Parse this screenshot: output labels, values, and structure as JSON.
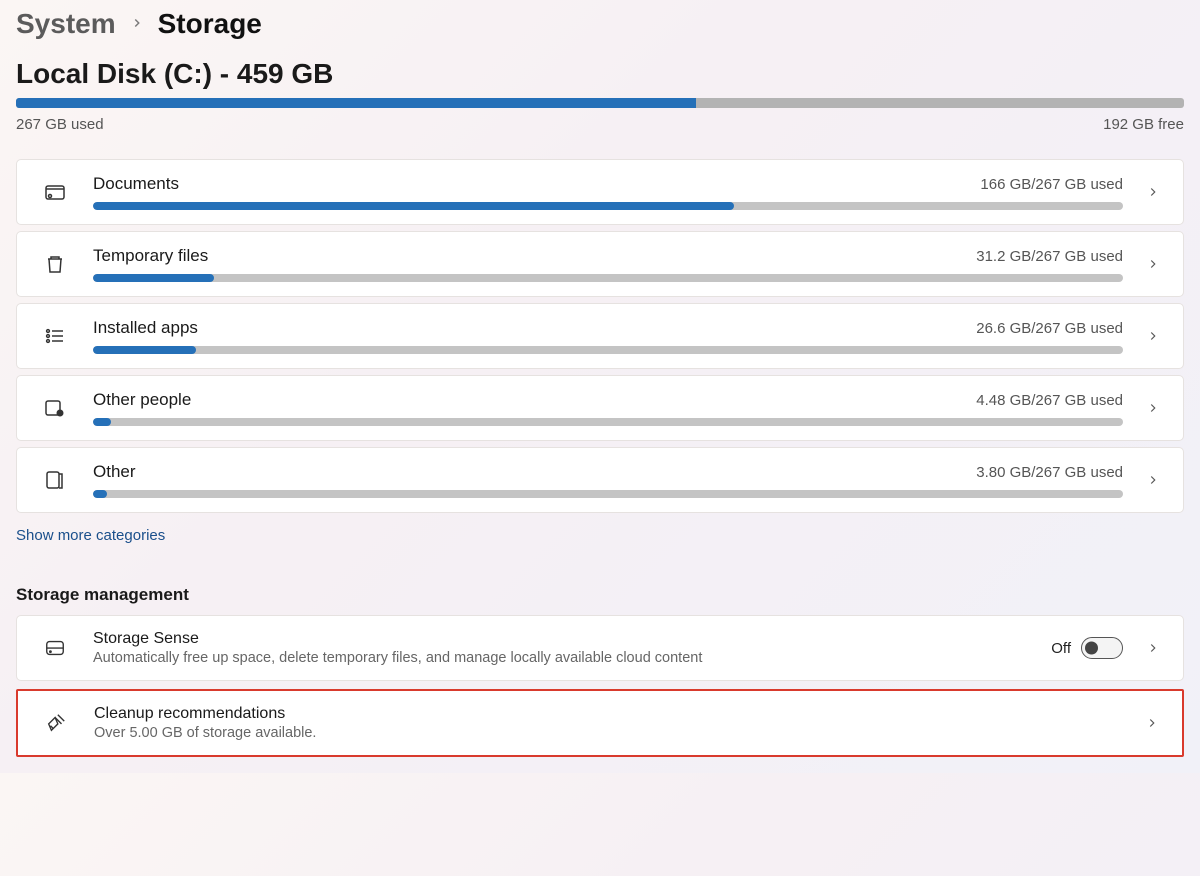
{
  "breadcrumb": {
    "parent": "System",
    "current": "Storage"
  },
  "disk": {
    "title": "Local Disk (C:) - 459 GB",
    "used_label": "267 GB used",
    "free_label": "192 GB free",
    "fill_pct": 58.2
  },
  "categories": [
    {
      "id": "documents",
      "title": "Documents",
      "usage": "166 GB/267 GB used",
      "fill_pct": 62.2,
      "icon": "documents"
    },
    {
      "id": "temp",
      "title": "Temporary files",
      "usage": "31.2 GB/267 GB used",
      "fill_pct": 11.7,
      "icon": "trash"
    },
    {
      "id": "apps",
      "title": "Installed apps",
      "usage": "26.6 GB/267 GB used",
      "fill_pct": 10.0,
      "icon": "apps"
    },
    {
      "id": "other-people",
      "title": "Other people",
      "usage": "4.48 GB/267 GB used",
      "fill_pct": 1.7,
      "icon": "people"
    },
    {
      "id": "other",
      "title": "Other",
      "usage": "3.80 GB/267 GB used",
      "fill_pct": 1.4,
      "icon": "other"
    }
  ],
  "show_more_label": "Show more categories",
  "mgmt_section_title": "Storage management",
  "storage_sense": {
    "title": "Storage Sense",
    "desc": "Automatically free up space, delete temporary files, and manage locally available cloud content",
    "toggle_state_label": "Off"
  },
  "cleanup": {
    "title": "Cleanup recommendations",
    "desc": "Over 5.00 GB of storage available."
  }
}
